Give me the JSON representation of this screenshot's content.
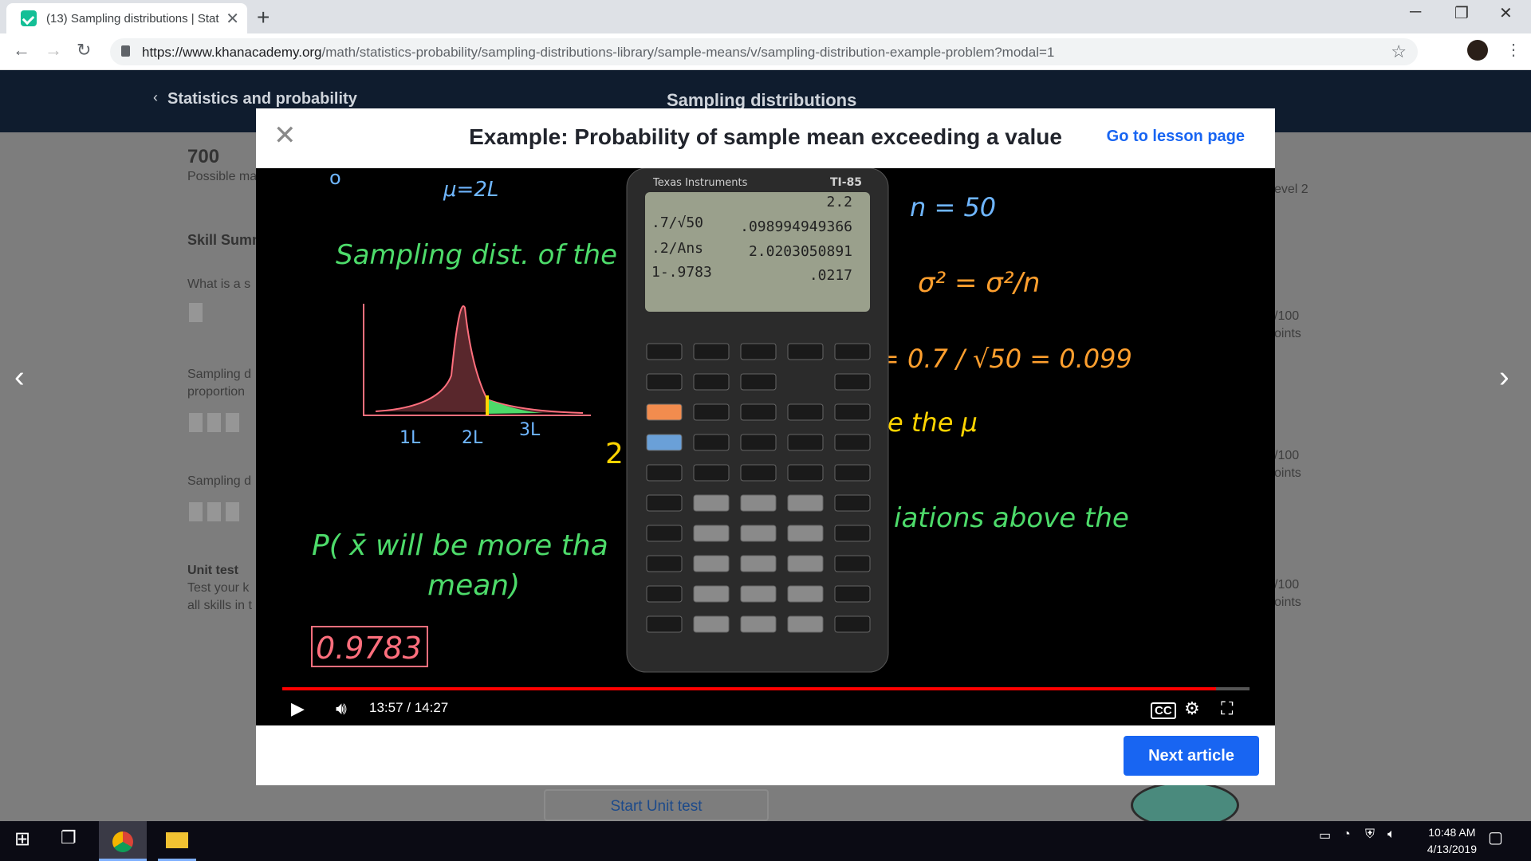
{
  "browser": {
    "tab_title": "(13) Sampling distributions | Stat",
    "url_host": "https://www.khanacademy.org",
    "url_path": "/math/statistics-probability/sampling-distributions-library/sample-means/v/sampling-distribution-example-problem?modal=1"
  },
  "background_page": {
    "breadcrumb": "Statistics and probability",
    "title": "Sampling distributions",
    "points_value": "700",
    "points_label": "Possible ma",
    "skill_summary": "Skill Summ",
    "item1": "What is a s",
    "item2_line1": "Sampling d",
    "item2_line2": "proportion",
    "item3": "Sampling d",
    "unit_test_title": "Unit test",
    "unit_test_line1": "Test your k",
    "unit_test_line2": "all skills in t",
    "level_label": "evel 2",
    "right_points": [
      "/100",
      "/100",
      "/100"
    ],
    "right_points_label": [
      "oints",
      "oints",
      "oints"
    ],
    "start_unit_test": "Start Unit test"
  },
  "modal": {
    "title": "Example: Probability of sample mean exceeding a value",
    "go_to_lesson": "Go to lesson page",
    "next_article": "Next article"
  },
  "video": {
    "current_time": "13:57",
    "duration": "14:27",
    "time_display": "13:57 / 14:27",
    "progress_fraction": 0.965,
    "board": {
      "mu": "μ=2L",
      "sampling_dist": "Sampling dist. of the",
      "n_eq": "n = 50",
      "x_labels": [
        "1L",
        "2L",
        "3L"
      ],
      "prob": "P( x̄ will be more tha",
      "mean": "mean)",
      "answer": "0.9783",
      "deviations": "iations above the",
      "the_mu": "e the μ",
      "sigma_calc": "= 0.7 / √50 = 0.099"
    },
    "calculator": {
      "brand": "Texas Instruments",
      "model": "TI-85",
      "screen_lines": [
        {
          "left": "",
          "right": "2.2"
        },
        {
          "left": ".7/√50",
          "right": ".098994949366"
        },
        {
          "left": ".2/Ans",
          "right": "2.0203050891"
        },
        {
          "left": "1-.9783",
          "right": ".0217"
        }
      ]
    }
  },
  "taskbar": {
    "time": "10:48 AM",
    "date": "4/13/2019"
  },
  "colors": {
    "khan_blue": "#1865f2",
    "chalk_green": "#4ddb6a",
    "chalk_pink": "#ff6f7d",
    "chalk_blue": "#6fb6ff"
  }
}
